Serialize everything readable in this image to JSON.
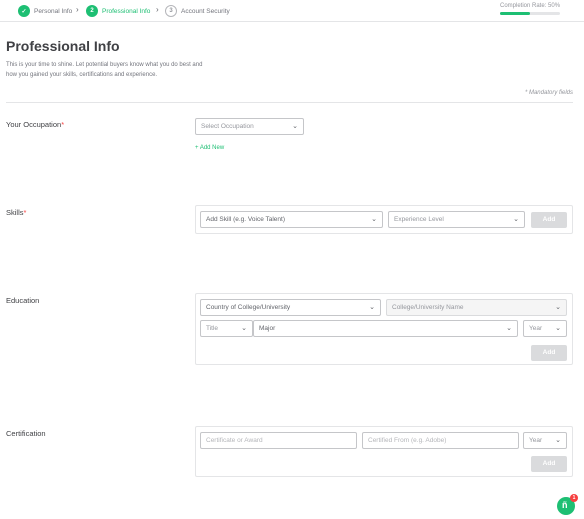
{
  "progress": {
    "steps": [
      {
        "label": "Personal Info",
        "marker": "✓"
      },
      {
        "label": "Professional Info",
        "marker": "2"
      },
      {
        "label": "Account Security",
        "marker": "3"
      }
    ],
    "completion_label": "Completion Rate: 50%",
    "completion_fraction": 0.5,
    "accent": "#1dbf73"
  },
  "header": {
    "title": "Professional Info",
    "intro": "This is your time to shine. Let potential buyers know what you do best and how you gained your skills, certifications and experience.",
    "mandatory": "* Mandatory fields"
  },
  "occupation": {
    "label": "Your Occupation",
    "required_mark": "*",
    "select_placeholder": "Select Occupation",
    "add_new": "+ Add New"
  },
  "skills": {
    "label": "Skills",
    "required_mark": "*",
    "skill_placeholder": "Add Skill (e.g. Voice Talent)",
    "level_placeholder": "Experience Level",
    "add_button": "Add"
  },
  "education": {
    "label": "Education",
    "country_placeholder": "Country of College/University",
    "college_placeholder": "College/University Name",
    "title_placeholder": "Title",
    "major_placeholder": "Major",
    "year_placeholder": "Year",
    "add_button": "Add"
  },
  "certification": {
    "label": "Certification",
    "certificate_placeholder": "Certificate or Award",
    "from_placeholder": "Certified From (e.g. Adobe)",
    "year_placeholder": "Year",
    "add_button": "Add"
  },
  "chat": {
    "icon": "chat-bubble-icon",
    "glyph": "ñ",
    "badge": "1"
  }
}
